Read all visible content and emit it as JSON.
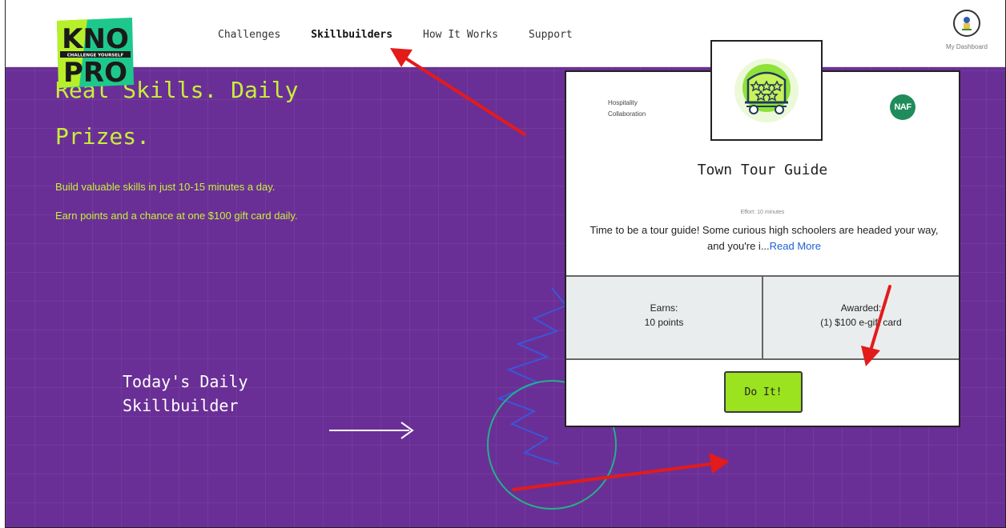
{
  "nav": {
    "items": [
      "Challenges",
      "Skillbuilders",
      "How It Works",
      "Support"
    ],
    "active": "Skillbuilders"
  },
  "logo": {
    "text_top": "KNO",
    "tagline": "CHALLENGE YOURSELF",
    "text_bottom": "PRO"
  },
  "dashboard": {
    "label": "My Dashboard"
  },
  "hero": {
    "headline_line1": "Real Skills. Daily",
    "headline_line2": "Prizes.",
    "sub1": "Build valuable skills in just 10-15 minutes a day.",
    "sub2": "Earn points and a chance at one $100 gift card daily.",
    "today_line1": "Today's Daily",
    "today_line2": "Skillbuilder"
  },
  "card": {
    "org_line1": "Hospitality",
    "org_line2": "Collaboration",
    "partner_badge": "NAF",
    "title": "Town Tour Guide",
    "effort": "Effort: 10 minutes",
    "description": "Time to be a tour guide! Some curious high schoolers are headed your way, and you're i...",
    "read_more": "Read More",
    "earns_label": "Earns:",
    "earns_value": "10 points",
    "awarded_label": "Awarded:",
    "awarded_value": "(1) $100 e-gift card",
    "cta": "Do It!"
  },
  "colors": {
    "hero_bg": "#6a2f96",
    "accent_green": "#c8ef3a",
    "button_green": "#9be21f",
    "annotation_red": "#e31b1b"
  },
  "icons": [
    "avatar-icon",
    "trolley-badge-icon",
    "naf-logo-icon",
    "right-arrow-icon"
  ]
}
